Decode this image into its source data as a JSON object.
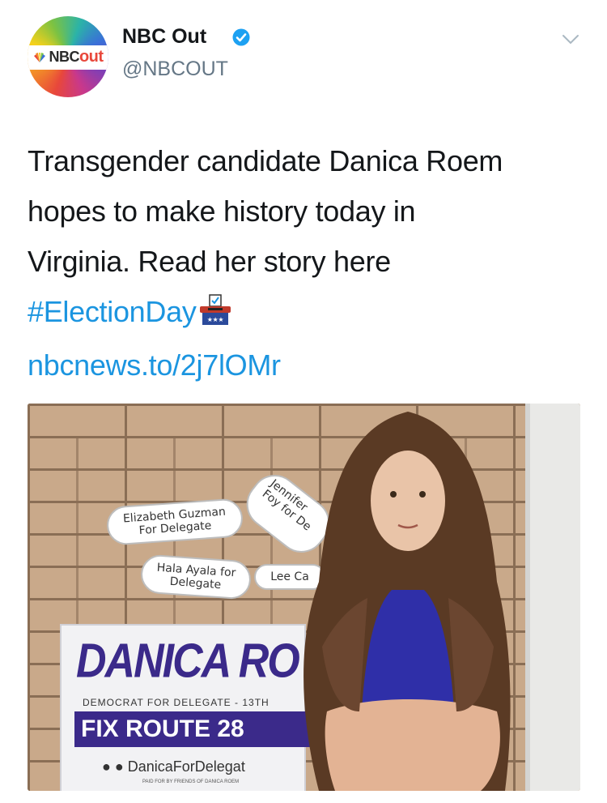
{
  "account": {
    "name": "NBC Out",
    "handle": "@NBCOUT",
    "avatar_logo_nbc": "NBC",
    "avatar_logo_out": "out",
    "verified": true
  },
  "tweet": {
    "line1": "Transgender candidate Danica Roem",
    "line2": "hopes to make history today in",
    "line3": "Virginia. Read her story here",
    "hashtag": "#ElectionDay",
    "link": "nbcnews.to/2j7lOMr"
  },
  "photo": {
    "bubble_1": "Elizabeth Guzman For Delegate",
    "bubble_2": "Hala Ayala for Delegate",
    "bubble_3": "Jennifer Foy for De",
    "bubble_4": "Lee Ca",
    "sign_title": "DANICA RO",
    "sign_subtitle": "DEMOCRAT FOR DELEGATE - 13TH",
    "sign_banner": "FIX ROUTE 28",
    "sign_social": "DanicaForDelegat",
    "sign_fine": "PAID FOR BY FRIENDS OF DANICA ROEM"
  },
  "icons": {
    "verified": "verified-badge-icon",
    "menu": "chevron-down-icon",
    "emoji": "ballot-box-icon"
  },
  "colors": {
    "link": "#1b95e0",
    "verified": "#1da1f2",
    "sign_purple": "#3b2a8a"
  }
}
